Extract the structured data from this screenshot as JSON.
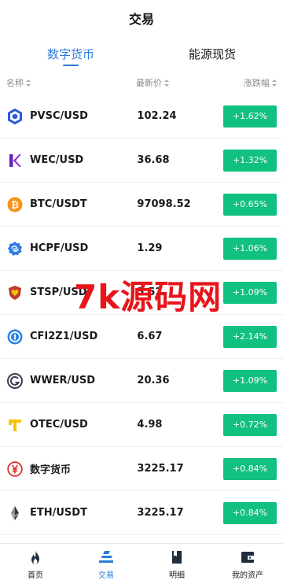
{
  "header": {
    "title": "交易"
  },
  "tabs": [
    {
      "label": "数字货币",
      "active": true
    },
    {
      "label": "能源现货",
      "active": false
    }
  ],
  "columns": {
    "name": "名称",
    "price": "最新价",
    "change": "涨跌幅"
  },
  "rows": [
    {
      "name": "PVSC/USD",
      "price": "102.24",
      "change": "+1.62%",
      "icon": "hexagon-chain-icon"
    },
    {
      "name": "WEC/USD",
      "price": "36.68",
      "change": "+1.32%",
      "icon": "k-logo-icon"
    },
    {
      "name": "BTC/USDT",
      "price": "97098.52",
      "change": "+0.65%",
      "icon": "bitcoin-icon"
    },
    {
      "name": "HCPF/USD",
      "price": "1.29",
      "change": "+1.06%",
      "icon": "swirl-badge-icon"
    },
    {
      "name": "STSP/USD",
      "price": "5.52",
      "change": "+1.09%",
      "icon": "heart-shield-icon"
    },
    {
      "name": "CFI2Z1/USD",
      "price": "6.67",
      "change": "+2.14%",
      "icon": "ring-coin-icon"
    },
    {
      "name": "WWER/USD",
      "price": "20.36",
      "change": "+1.09%",
      "icon": "g-circle-icon"
    },
    {
      "name": "OTEC/USD",
      "price": "4.98",
      "change": "+0.72%",
      "icon": "t-logo-icon"
    },
    {
      "name": "数字货币",
      "price": "3225.17",
      "change": "+0.84%",
      "icon": "yuan-circle-icon"
    },
    {
      "name": "ETH/USDT",
      "price": "3225.17",
      "change": "+0.84%",
      "icon": "ethereum-icon"
    }
  ],
  "watermark": "7k源码网",
  "nav": [
    {
      "label": "首页",
      "icon": "flame-icon",
      "active": false
    },
    {
      "label": "交易",
      "icon": "trade-icon",
      "active": true
    },
    {
      "label": "明细",
      "icon": "document-icon",
      "active": false
    },
    {
      "label": "我的资产",
      "icon": "wallet-icon",
      "active": false
    }
  ],
  "colors": {
    "accent": "#2b7bd6",
    "up": "#11c17f",
    "watermark": "#e8141b"
  }
}
